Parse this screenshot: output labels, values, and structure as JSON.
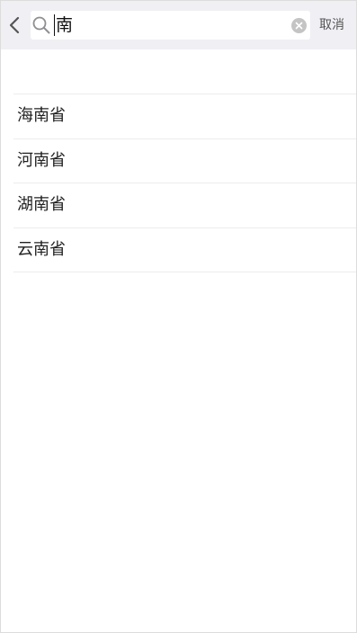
{
  "search": {
    "query": "南",
    "cancel_label": "取消"
  },
  "results": [
    "海南省",
    "河南省",
    "湖南省",
    "云南省"
  ]
}
